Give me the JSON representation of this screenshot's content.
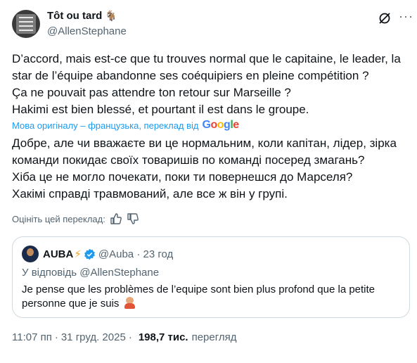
{
  "author": {
    "display_name": "Tôt ou tard",
    "handle": "@AllenStephane",
    "name_emoji": "goat-icon"
  },
  "tweet": {
    "lines": [
      "D’accord, mais est-ce que tu trouves normal que le capitaine, le leader, la",
      "star de l’équipe abandonne ses coéquipiers en pleine compétition ?",
      "Ça ne pouvait pas attendre ton  retour sur Marseille ?",
      "Hakimi est bien blessé, et pourtant il est dans le groupe."
    ]
  },
  "translation": {
    "credit": "Мова оригіналу – французька, переклад від",
    "provider_letters": [
      "G",
      "o",
      "o",
      "g",
      "l",
      "e"
    ],
    "lines": [
      "Добре, але чи вважаєте ви це нормальним, коли капітан, лідер, зірка",
      "команди покидає своїх товаришів по команді посеред змагань?",
      "Хіба це не могло почекати, поки ти повернешся до Марселя?",
      "Хакімі справді травмований, але все ж він у групі."
    ],
    "rate_label": "Оцініть цей переклад:"
  },
  "quote": {
    "name": "AUBA",
    "handle": "@Auba",
    "time": "23 год",
    "reply_to": "У відповідь @AllenStephane",
    "text": "Je pense que les problèmes de l’equipe sont bien plus profond que la petite personne que je suis"
  },
  "meta": {
    "time": "11:07 пп",
    "date": "31 груд. 2025",
    "views": "198,7 тис.",
    "views_label": "перегляд"
  },
  "colors": {
    "accent": "#1d9bf0",
    "secondary_text": "#536471",
    "border": "#cfd9de",
    "bolt": "#f5a623"
  }
}
